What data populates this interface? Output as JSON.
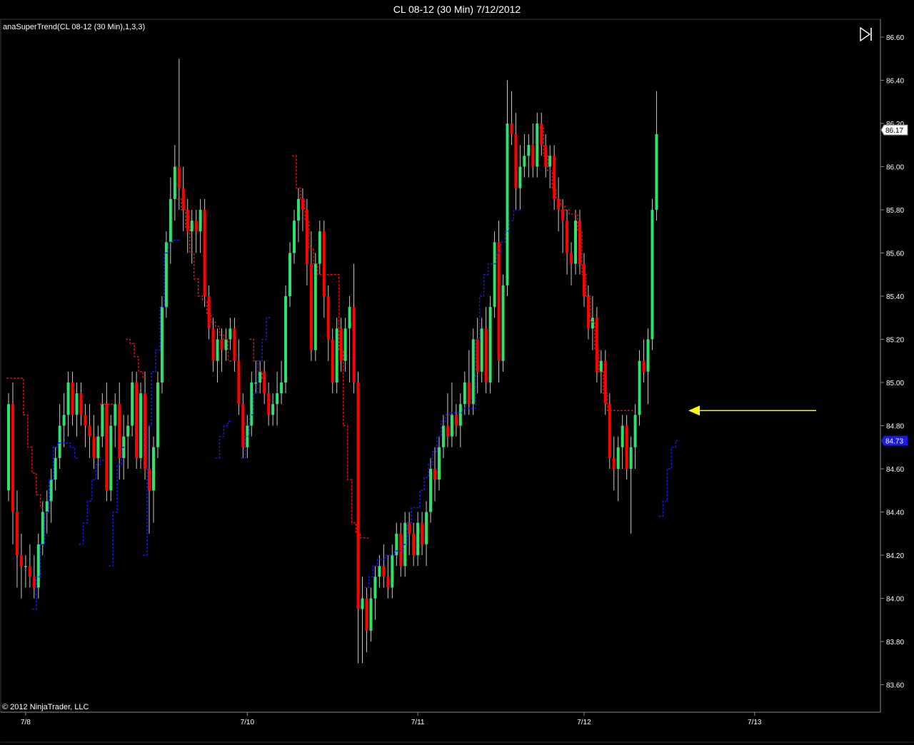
{
  "header": {
    "title": "CL 08-12 (30 Min)  7/12/2012"
  },
  "indicator": {
    "label": "anaSuperTrend(CL 08-12 (30 Min),1,3,3)"
  },
  "footer": {
    "copyright": "© 2012 NinjaTrader, LLC"
  },
  "icons": {
    "play_to_end": "skip-to-end-icon"
  },
  "colors": {
    "background": "#000000",
    "up_candle": "#2EE06E",
    "down_candle": "#FF0000",
    "wick": "#C8C8C8",
    "supertrend_up": "#1A1AE0",
    "supertrend_down": "#E01010",
    "arrow": "#FFFF00",
    "last_price_tag": "#FFFFFF",
    "indicator_tag": "#1A1AE0"
  },
  "chart_data": {
    "type": "candlestick",
    "instrument": "CL 08-12",
    "interval": "30 Min",
    "ylim": [
      83.5,
      86.65
    ],
    "y_ticks": [
      "86.60",
      "86.40",
      "86.20",
      "86.00",
      "85.80",
      "85.60",
      "85.40",
      "85.20",
      "85.00",
      "84.80",
      "84.60",
      "84.40",
      "84.20",
      "84.00",
      "83.80",
      "83.60"
    ],
    "x_ticks": [
      {
        "label": "7/8",
        "bar": 4
      },
      {
        "label": "7/10",
        "bar": 56
      },
      {
        "label": "7/11",
        "bar": 96
      },
      {
        "label": "7/12",
        "bar": 135
      },
      {
        "label": "7/13",
        "bar": 175
      }
    ],
    "last_price": "86.17",
    "indicator_value": "84.73",
    "arrow_price": 84.87,
    "candles": [
      [
        84.5,
        84.95,
        84.45,
        84.9
      ],
      [
        84.9,
        85.0,
        84.25,
        84.4
      ],
      [
        84.4,
        84.5,
        84.05,
        84.2
      ],
      [
        84.2,
        84.3,
        84.0,
        84.15
      ],
      [
        84.15,
        84.2,
        84.05,
        84.15
      ],
      [
        84.15,
        84.25,
        84.05,
        84.1
      ],
      [
        84.1,
        84.2,
        84.0,
        84.05
      ],
      [
        84.05,
        84.3,
        84.0,
        84.25
      ],
      [
        84.25,
        84.45,
        84.2,
        84.4
      ],
      [
        84.4,
        84.5,
        84.3,
        84.45
      ],
      [
        84.45,
        84.6,
        84.35,
        84.55
      ],
      [
        84.55,
        84.7,
        84.5,
        84.65
      ],
      [
        84.65,
        84.9,
        84.6,
        84.8
      ],
      [
        84.8,
        84.95,
        84.7,
        84.85
      ],
      [
        84.85,
        85.05,
        84.75,
        85.0
      ],
      [
        85.0,
        85.05,
        84.8,
        84.85
      ],
      [
        84.85,
        85.0,
        84.75,
        84.95
      ],
      [
        84.95,
        85.0,
        84.8,
        84.85
      ],
      [
        84.85,
        84.9,
        84.7,
        84.8
      ],
      [
        84.8,
        84.9,
        84.65,
        84.75
      ],
      [
        84.75,
        84.85,
        84.6,
        84.65
      ],
      [
        84.65,
        84.8,
        84.55,
        84.75
      ],
      [
        84.75,
        84.95,
        84.7,
        84.9
      ],
      [
        84.9,
        85.0,
        84.45,
        84.5
      ],
      [
        84.5,
        84.85,
        84.45,
        84.8
      ],
      [
        84.8,
        84.95,
        84.7,
        84.9
      ],
      [
        84.9,
        85.0,
        84.55,
        84.65
      ],
      [
        84.65,
        84.85,
        84.55,
        84.75
      ],
      [
        84.75,
        84.85,
        84.6,
        84.8
      ],
      [
        84.8,
        85.05,
        84.75,
        85.0
      ],
      [
        85.0,
        85.05,
        84.6,
        84.65
      ],
      [
        84.65,
        85.0,
        84.6,
        84.95
      ],
      [
        84.95,
        85.05,
        84.55,
        84.6
      ],
      [
        84.6,
        84.8,
        84.3,
        84.5
      ],
      [
        84.5,
        84.75,
        84.35,
        84.7
      ],
      [
        84.7,
        85.05,
        84.65,
        85.0
      ],
      [
        85.0,
        85.4,
        84.95,
        85.35
      ],
      [
        85.35,
        85.7,
        85.3,
        85.65
      ],
      [
        85.65,
        85.95,
        85.55,
        85.85
      ],
      [
        85.85,
        86.1,
        85.75,
        86.0
      ],
      [
        86.0,
        86.5,
        85.8,
        85.9
      ],
      [
        85.9,
        86.0,
        85.7,
        85.8
      ],
      [
        85.8,
        85.85,
        85.6,
        85.7
      ],
      [
        85.7,
        85.8,
        85.55,
        85.75
      ],
      [
        85.75,
        85.8,
        85.6,
        85.7
      ],
      [
        85.7,
        85.85,
        85.6,
        85.8
      ],
      [
        85.8,
        85.85,
        85.35,
        85.4
      ],
      [
        85.4,
        85.45,
        85.2,
        85.25
      ],
      [
        85.25,
        85.3,
        85.05,
        85.1
      ],
      [
        85.1,
        85.25,
        85.0,
        85.2
      ],
      [
        85.2,
        85.25,
        85.05,
        85.15
      ],
      [
        85.15,
        85.25,
        85.1,
        85.2
      ],
      [
        85.2,
        85.3,
        85.15,
        85.25
      ],
      [
        85.25,
        85.3,
        85.05,
        85.1
      ],
      [
        85.1,
        85.2,
        84.85,
        84.9
      ],
      [
        84.9,
        84.95,
        84.65,
        84.7
      ],
      [
        84.7,
        84.85,
        84.65,
        84.8
      ],
      [
        84.8,
        85.05,
        84.75,
        85.0
      ],
      [
        85.0,
        85.1,
        84.95,
        85.0
      ],
      [
        85.0,
        85.1,
        84.95,
        85.05
      ],
      [
        85.05,
        85.1,
        84.9,
        84.95
      ],
      [
        84.95,
        85.0,
        84.8,
        84.85
      ],
      [
        84.85,
        84.95,
        84.8,
        84.9
      ],
      [
        84.9,
        85.05,
        84.8,
        84.95
      ],
      [
        84.95,
        85.1,
        84.9,
        85.0
      ],
      [
        85.0,
        85.45,
        84.95,
        85.4
      ],
      [
        85.4,
        85.65,
        85.35,
        85.6
      ],
      [
        85.6,
        85.8,
        85.55,
        85.75
      ],
      [
        85.75,
        85.9,
        85.65,
        85.85
      ],
      [
        85.85,
        85.9,
        85.7,
        85.8
      ],
      [
        85.8,
        85.85,
        85.45,
        85.55
      ],
      [
        85.55,
        85.7,
        85.1,
        85.15
      ],
      [
        85.15,
        85.6,
        85.1,
        85.55
      ],
      [
        85.55,
        85.75,
        85.5,
        85.7
      ],
      [
        85.7,
        85.75,
        85.3,
        85.4
      ],
      [
        85.4,
        85.45,
        85.1,
        85.2
      ],
      [
        85.2,
        85.25,
        84.95,
        85.0
      ],
      [
        85.0,
        85.3,
        84.95,
        85.25
      ],
      [
        85.25,
        85.3,
        85.05,
        85.1
      ],
      [
        85.1,
        85.3,
        85.05,
        85.25
      ],
      [
        85.25,
        85.4,
        85.0,
        85.35
      ],
      [
        85.35,
        85.55,
        84.95,
        85.0
      ],
      [
        85.0,
        85.05,
        83.7,
        83.95
      ],
      [
        83.95,
        84.1,
        83.7,
        84.0
      ],
      [
        84.0,
        84.05,
        83.75,
        83.85
      ],
      [
        83.85,
        84.05,
        83.8,
        84.0
      ],
      [
        84.0,
        84.15,
        83.9,
        84.1
      ],
      [
        84.1,
        84.2,
        84.05,
        84.15
      ],
      [
        84.15,
        84.25,
        84.05,
        84.1
      ],
      [
        84.1,
        84.2,
        84.0,
        84.05
      ],
      [
        84.05,
        84.25,
        84.0,
        84.2
      ],
      [
        84.2,
        84.35,
        84.15,
        84.3
      ],
      [
        84.3,
        84.35,
        84.1,
        84.15
      ],
      [
        84.15,
        84.4,
        84.1,
        84.35
      ],
      [
        84.35,
        84.4,
        84.2,
        84.3
      ],
      [
        84.3,
        84.35,
        84.15,
        84.2
      ],
      [
        84.2,
        84.4,
        84.15,
        84.35
      ],
      [
        84.35,
        84.4,
        84.2,
        84.25
      ],
      [
        84.25,
        84.45,
        84.15,
        84.4
      ],
      [
        84.4,
        84.65,
        84.35,
        84.6
      ],
      [
        84.6,
        84.7,
        84.45,
        84.55
      ],
      [
        84.55,
        84.75,
        84.5,
        84.7
      ],
      [
        84.7,
        84.85,
        84.65,
        84.8
      ],
      [
        84.8,
        84.95,
        84.7,
        84.75
      ],
      [
        84.75,
        85.0,
        84.7,
        84.85
      ],
      [
        84.85,
        84.9,
        84.75,
        84.8
      ],
      [
        84.8,
        84.95,
        84.7,
        84.9
      ],
      [
        84.9,
        85.05,
        84.85,
        85.0
      ],
      [
        85.0,
        85.15,
        84.85,
        84.9
      ],
      [
        84.9,
        85.25,
        84.85,
        85.2
      ],
      [
        85.2,
        85.3,
        84.95,
        85.05
      ],
      [
        85.05,
        85.3,
        85.0,
        85.25
      ],
      [
        85.25,
        85.35,
        84.95,
        85.0
      ],
      [
        85.0,
        85.4,
        84.95,
        85.35
      ],
      [
        85.35,
        85.7,
        85.3,
        85.65
      ],
      [
        85.65,
        85.75,
        85.0,
        85.1
      ],
      [
        85.1,
        85.5,
        85.05,
        85.45
      ],
      [
        85.45,
        86.4,
        85.4,
        86.2
      ],
      [
        86.2,
        86.35,
        86.1,
        86.15
      ],
      [
        86.15,
        86.25,
        85.8,
        85.9
      ],
      [
        85.9,
        86.1,
        85.8,
        86.0
      ],
      [
        86.0,
        86.15,
        85.95,
        86.05
      ],
      [
        86.05,
        86.15,
        85.95,
        86.1
      ],
      [
        86.1,
        86.2,
        85.95,
        86.0
      ],
      [
        86.0,
        86.25,
        85.95,
        86.2
      ],
      [
        86.2,
        86.25,
        86.05,
        86.1
      ],
      [
        86.1,
        86.15,
        85.95,
        86.0
      ],
      [
        86.0,
        86.1,
        85.9,
        86.05
      ],
      [
        86.05,
        86.1,
        85.8,
        85.85
      ],
      [
        85.85,
        85.95,
        85.7,
        85.8
      ],
      [
        85.8,
        85.85,
        85.6,
        85.75
      ],
      [
        85.75,
        85.8,
        85.5,
        85.6
      ],
      [
        85.6,
        85.65,
        85.45,
        85.55
      ],
      [
        85.55,
        85.8,
        85.5,
        85.75
      ],
      [
        85.75,
        85.8,
        85.5,
        85.55
      ],
      [
        85.55,
        85.6,
        85.35,
        85.4
      ],
      [
        85.4,
        85.45,
        85.2,
        85.25
      ],
      [
        85.25,
        85.4,
        85.15,
        85.3
      ],
      [
        85.3,
        85.35,
        85.0,
        85.05
      ],
      [
        85.05,
        85.15,
        84.95,
        85.1
      ],
      [
        85.1,
        85.15,
        84.85,
        84.9
      ],
      [
        84.9,
        84.95,
        84.6,
        84.65
      ],
      [
        84.65,
        84.75,
        84.5,
        84.6
      ],
      [
        84.6,
        84.75,
        84.45,
        84.7
      ],
      [
        84.7,
        84.85,
        84.6,
        84.8
      ],
      [
        84.8,
        84.85,
        84.55,
        84.6
      ],
      [
        84.6,
        84.75,
        84.3,
        84.7
      ],
      [
        84.7,
        84.9,
        84.6,
        84.85
      ],
      [
        84.85,
        85.15,
        84.8,
        85.1
      ],
      [
        85.1,
        85.2,
        85.0,
        85.05
      ],
      [
        85.05,
        85.25,
        84.9,
        85.2
      ],
      [
        85.2,
        85.85,
        85.15,
        85.8
      ],
      [
        85.8,
        86.35,
        85.75,
        86.15
      ]
    ],
    "supertrend_down_segments": [
      {
        "start": 0,
        "values": [
          85.02,
          85.02,
          85.02,
          85.02,
          84.85,
          84.7,
          84.58,
          84.48,
          84.42
        ]
      },
      {
        "start": 22,
        "values": [
          84.9,
          84.9,
          84.9
        ]
      },
      {
        "start": 28,
        "values": [
          85.2,
          85.18,
          85.12,
          85.05,
          85.02
        ]
      },
      {
        "start": 40,
        "values": [
          85.85,
          85.8,
          85.72,
          85.6,
          85.48,
          85.4,
          85.38,
          85.32,
          85.28,
          85.26,
          85.22,
          85.2,
          85.1
        ]
      },
      {
        "start": 57,
        "values": [
          85.2,
          85.1,
          85.05,
          85.02
        ]
      },
      {
        "start": 67,
        "values": [
          86.05,
          85.9,
          85.85,
          85.75,
          85.62,
          85.55,
          85.5,
          85.5,
          85.5,
          85.5,
          85.5,
          85.15,
          84.8,
          84.55,
          84.35,
          84.3,
          84.28,
          84.28
        ]
      },
      {
        "start": 125,
        "values": [
          86.18,
          86.05,
          85.98,
          85.9,
          85.85,
          85.82,
          85.8,
          85.78,
          85.78,
          85.7,
          85.5,
          85.4,
          85.28,
          85.15,
          85.05,
          84.95,
          84.87,
          84.87,
          84.87,
          84.87,
          84.87,
          84.87
        ]
      }
    ],
    "supertrend_up_segments": [
      {
        "start": 6,
        "values": [
          83.95,
          84.1,
          84.25,
          84.4,
          84.55,
          84.7,
          84.72,
          84.72,
          84.72,
          84.7,
          84.65
        ]
      },
      {
        "start": 17,
        "values": [
          84.25,
          84.35,
          84.45,
          84.55,
          84.62,
          84.64
        ]
      },
      {
        "start": 24,
        "values": [
          84.15,
          84.4,
          84.62,
          84.7
        ]
      },
      {
        "start": 32,
        "values": [
          84.2,
          84.8,
          85.05,
          85.15,
          85.35,
          85.6,
          85.65,
          85.66,
          85.66
        ]
      },
      {
        "start": 49,
        "values": [
          84.65,
          84.75,
          84.8,
          84.82
        ]
      },
      {
        "start": 55,
        "values": [
          84.65,
          84.75,
          84.85,
          84.95,
          85.1,
          85.2,
          85.3
        ]
      },
      {
        "start": 84,
        "values": [
          84.05,
          84.1,
          84.15,
          84.18,
          84.18,
          84.2,
          84.2,
          84.22,
          84.22,
          84.25,
          84.35,
          84.42,
          84.42,
          84.5,
          84.56,
          84.62,
          84.68,
          84.75,
          84.82,
          84.85,
          84.86,
          84.86,
          84.86,
          84.88,
          84.88,
          84.88,
          85.2,
          85.4,
          85.5,
          85.55,
          85.55,
          85.6,
          85.65,
          85.7,
          85.75,
          85.8,
          85.8
        ]
      },
      {
        "start": 153,
        "values": [
          84.38,
          84.45,
          84.6,
          84.7,
          84.73
        ]
      }
    ]
  }
}
